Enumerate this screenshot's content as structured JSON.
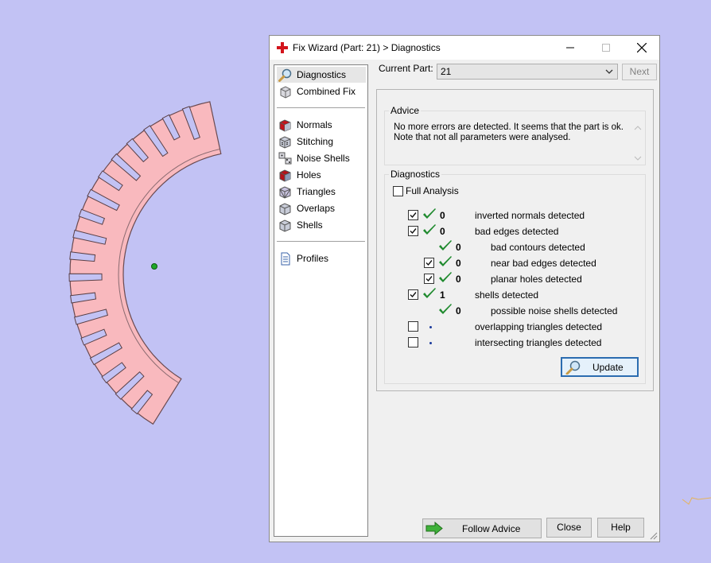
{
  "window": {
    "title": "Fix Wizard (Part: 21) > Diagnostics"
  },
  "nav": {
    "top": [
      {
        "label": "Diagnostics",
        "icon": "magnifier-icon",
        "selected": true
      },
      {
        "label": "Combined Fix",
        "icon": "cube-icon"
      }
    ],
    "fixes": [
      {
        "label": "Normals",
        "icon": "normals-cube-icon"
      },
      {
        "label": "Stitching",
        "icon": "stitching-cube-icon"
      },
      {
        "label": "Noise Shells",
        "icon": "noise-dice-icon"
      },
      {
        "label": "Holes",
        "icon": "holes-cube-icon"
      },
      {
        "label": "Triangles",
        "icon": "triangles-cube-icon"
      },
      {
        "label": "Overlaps",
        "icon": "overlaps-cube-icon"
      },
      {
        "label": "Shells",
        "icon": "shells-cube-icon"
      }
    ],
    "bottom": [
      {
        "label": "Profiles",
        "icon": "document-icon"
      }
    ]
  },
  "current_part": {
    "label": "Current Part:",
    "value": "21"
  },
  "buttons": {
    "next": "Next",
    "update": "Update",
    "follow_advice": "Follow Advice",
    "close": "Close",
    "help": "Help"
  },
  "advice": {
    "title": "Advice",
    "line1": "No more errors are detected. It seems that the part is ok.",
    "line2": "Note that not all parameters were analysed."
  },
  "diagnostics": {
    "title": "Diagnostics",
    "full_analysis": "Full Analysis",
    "rows": [
      {
        "checkbox": true,
        "checked": true,
        "indent": 0,
        "status": "ok",
        "count": "0",
        "label": "inverted normals detected"
      },
      {
        "checkbox": true,
        "checked": true,
        "indent": 0,
        "status": "ok",
        "count": "0",
        "label": "bad edges detected"
      },
      {
        "checkbox": false,
        "checked": false,
        "indent": 1,
        "status": "ok",
        "count": "0",
        "label": "bad contours detected"
      },
      {
        "checkbox": true,
        "checked": true,
        "indent": 1,
        "status": "ok",
        "count": "0",
        "label": "near bad edges detected"
      },
      {
        "checkbox": true,
        "checked": true,
        "indent": 1,
        "status": "ok",
        "count": "0",
        "label": "planar holes detected"
      },
      {
        "checkbox": true,
        "checked": true,
        "indent": 0,
        "status": "ok",
        "count": "1",
        "label": "shells detected"
      },
      {
        "checkbox": false,
        "checked": false,
        "indent": 1,
        "status": "ok",
        "count": "0",
        "label": "possible noise shells detected"
      },
      {
        "checkbox": true,
        "checked": false,
        "indent": 0,
        "status": "pending",
        "count": "",
        "label": "overlapping triangles detected"
      },
      {
        "checkbox": true,
        "checked": false,
        "indent": 0,
        "status": "pending",
        "count": "",
        "label": "intersecting triangles detected"
      }
    ]
  },
  "colors": {
    "background": "#c2c2f4",
    "part": "#f9b9be",
    "check": "#1f8a2e",
    "selection": "#e6e6e6"
  }
}
